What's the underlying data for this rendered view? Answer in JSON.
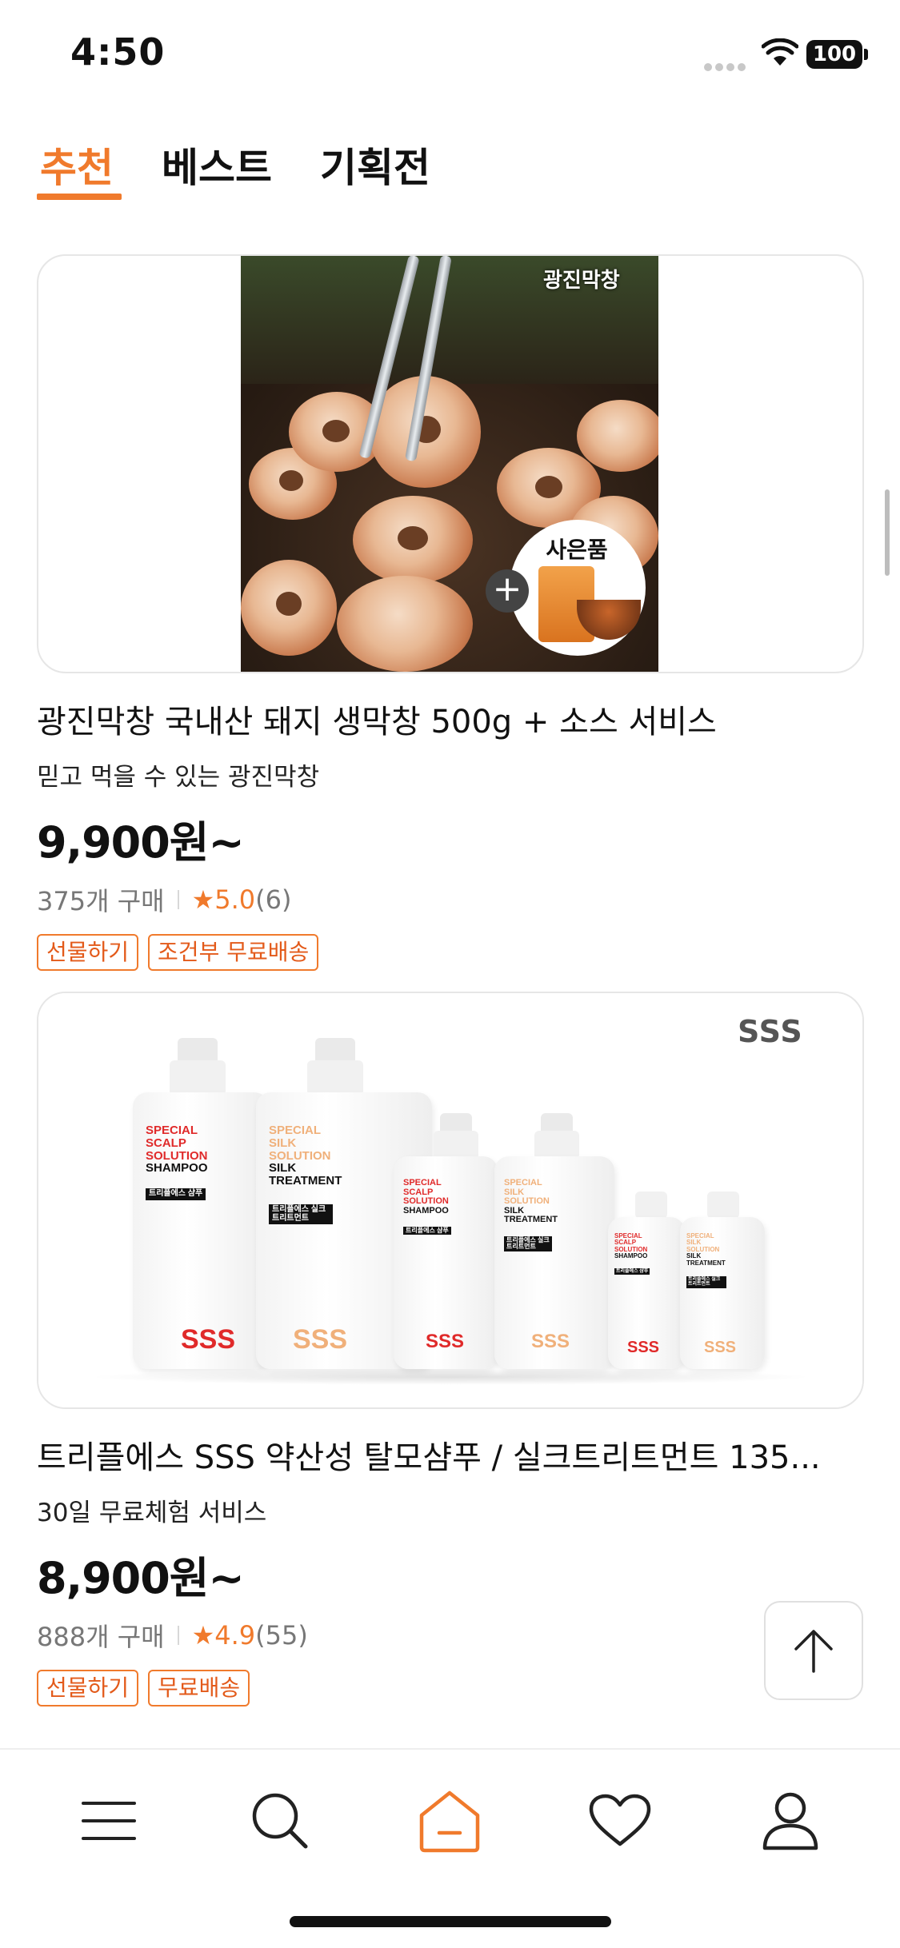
{
  "status_bar": {
    "time": "4:50",
    "battery": "100"
  },
  "tabs": [
    {
      "label": "추천",
      "active": true
    },
    {
      "label": "베스트",
      "active": false
    },
    {
      "label": "기획전",
      "active": false
    }
  ],
  "products": [
    {
      "image": {
        "brand_logo": "광진막창",
        "gift_label": "사은품",
        "plus": "+"
      },
      "title": "광진막창 국내산 돼지 생막창 500g + 소스 서비스",
      "subtitle": "믿고 먹을 수 있는 광진막창",
      "price": "9,900원~",
      "purchases": "375개 구매",
      "star": "★",
      "rating": "5.0",
      "reviews": "(6)",
      "badges": [
        "선물하기",
        "조건부 무료배송"
      ]
    },
    {
      "image": {
        "brand_logo": "SSS",
        "bottles": [
          {
            "lines": [
              "SPECIAL",
              "SCALP",
              "SOLUTION",
              "SHAMPOO"
            ],
            "tag": "트리플에스 샴푸",
            "brand": "SSS",
            "tone": "red"
          },
          {
            "lines": [
              "SPECIAL",
              "SILK",
              "SOLUTION",
              "SILK",
              "TREATMENT"
            ],
            "tag": "트리플에스 실크 트리트먼트",
            "brand": "SSS",
            "tone": "peach"
          },
          {
            "lines": [
              "SPECIAL",
              "SCALP",
              "SOLUTION",
              "SHAMPOO"
            ],
            "tag": "트리플에스 샴푸",
            "brand": "SSS",
            "tone": "red"
          },
          {
            "lines": [
              "SPECIAL",
              "SILK",
              "SOLUTION",
              "SILK",
              "TREATMENT"
            ],
            "tag": "트리플에스 실크 트리트먼트",
            "brand": "SSS",
            "tone": "peach"
          },
          {
            "lines": [
              "SPECIAL",
              "SCALP",
              "SOLUTION",
              "SHAMPOO"
            ],
            "tag": "트리플에스 샴푸",
            "brand": "SSS",
            "tone": "red"
          },
          {
            "lines": [
              "SPECIAL",
              "SILK",
              "SOLUTION",
              "SILK",
              "TREATMENT"
            ],
            "tag": "트리플에스 실크 트리트먼트",
            "brand": "SSS",
            "tone": "peach"
          }
        ]
      },
      "title": "트리플에스 SSS 약산성 탈모샴푸 / 실크트리트먼트 135...",
      "subtitle": "30일 무료체험 서비스",
      "price": "8,900원~",
      "purchases": "888개 구매",
      "star": "★",
      "rating": "4.9",
      "reviews": "(55)",
      "badges": [
        "선물하기",
        "무료배송"
      ]
    }
  ],
  "bottom_nav": [
    {
      "icon": "menu-icon"
    },
    {
      "icon": "search-icon"
    },
    {
      "icon": "home-icon",
      "active": true
    },
    {
      "icon": "heart-icon"
    },
    {
      "icon": "profile-icon"
    }
  ],
  "colors": {
    "accent": "#f07a2c",
    "text": "#111111",
    "muted": "#777777",
    "border": "#e6e6e6"
  }
}
